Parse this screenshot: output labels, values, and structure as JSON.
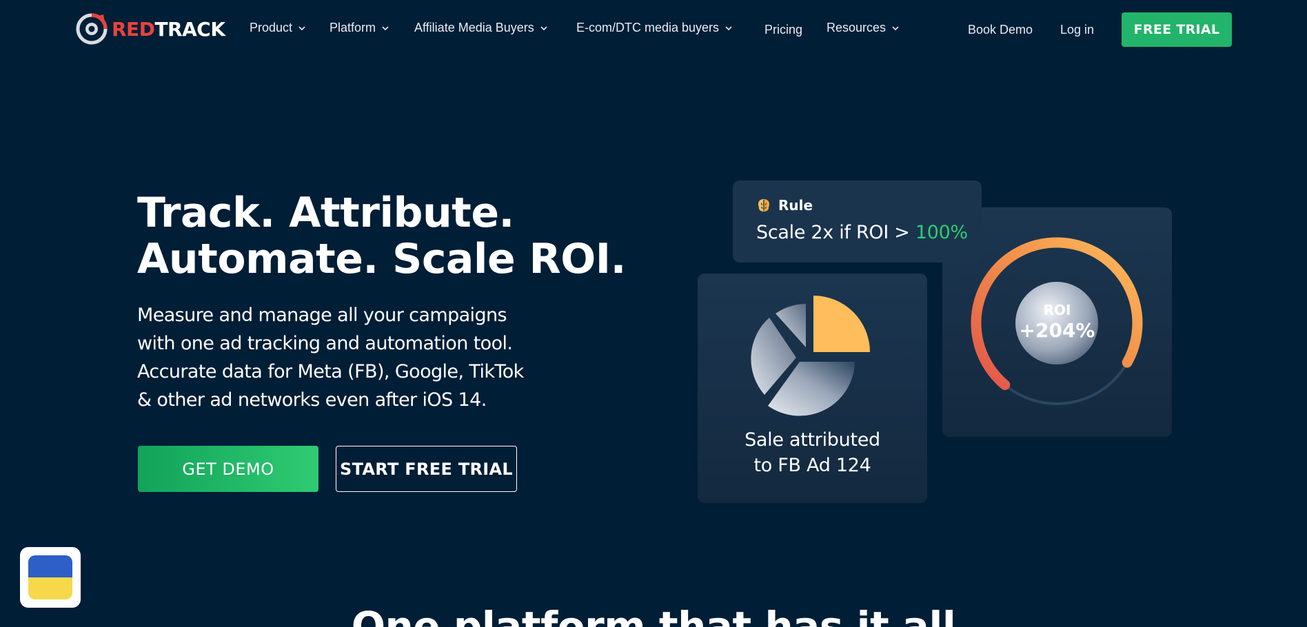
{
  "brand": {
    "logo_red": "RED",
    "logo_white": "TRACK"
  },
  "nav": {
    "items": [
      {
        "label": "Product",
        "dropdown": true
      },
      {
        "label": "Platform",
        "dropdown": true
      },
      {
        "label": "Affiliate Media Buyers",
        "dropdown": true
      },
      {
        "label": "E-com/DTC media buyers",
        "dropdown": true
      },
      {
        "label": "Pricing",
        "dropdown": false
      },
      {
        "label": "Resources",
        "dropdown": true
      }
    ],
    "book_demo": "Book Demo",
    "login": "Log in",
    "free_trial": "FREE TRIAL"
  },
  "hero": {
    "title_line1": "Track. Attribute.",
    "title_line2": "Automate. Scale ROI.",
    "sub_lines": [
      "Measure and manage all your campaigns",
      "with one ad tracking and automation tool.",
      "Accurate data for Meta (FB), Google, TikTok",
      "& other ad networks even after iOS 14."
    ],
    "cta_demo": "GET DEMO",
    "cta_trial": "START FREE TRIAL"
  },
  "cards": {
    "rule": {
      "icon": "brain-icon",
      "title": "Rule",
      "text_prefix": "Scale 2x if ROI > ",
      "text_highlight": "100%"
    },
    "sale": {
      "icon": "pie-chart-icon",
      "line1": "Sale attributed",
      "line2": "to FB Ad 124"
    },
    "roi": {
      "label": "ROI",
      "value": "+204%",
      "gauge_fraction": 0.72
    }
  },
  "colors": {
    "background": "#001e36",
    "accent_green": "#22b46a",
    "brand_red": "#e8433b",
    "highlight_green": "#2fcb72",
    "pie_yellow": "#ffbd5c"
  },
  "ukraine_badge": {
    "icon": "ukraine-flag-icon"
  },
  "section": {
    "heading": "One platform that has it all"
  }
}
